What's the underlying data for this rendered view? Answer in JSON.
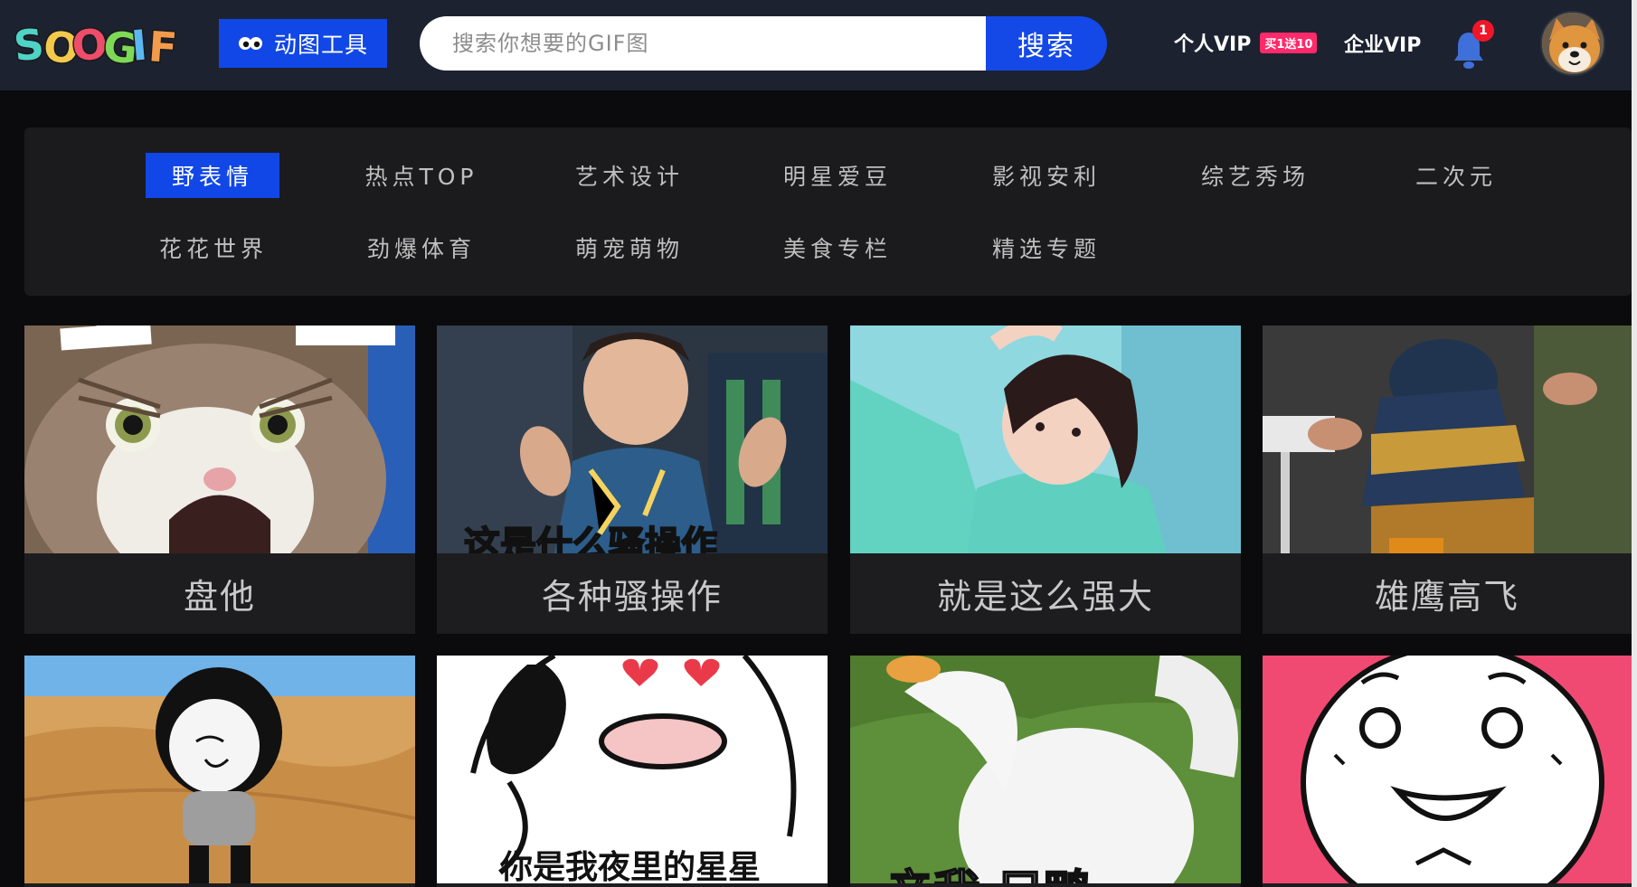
{
  "header": {
    "logo_text": "SOOGIF",
    "tool_button": "动图工具",
    "search_placeholder": "搜索你想要的GIF图",
    "search_button": "搜索",
    "vip_label": "个人VIP",
    "vip_badge": "买1送10",
    "biz_vip_label": "企业VIP",
    "notification_count": "1"
  },
  "categories": [
    {
      "label": "野表情",
      "active": true
    },
    {
      "label": "热点TOP"
    },
    {
      "label": "艺术设计"
    },
    {
      "label": "明星爱豆"
    },
    {
      "label": "影视安利"
    },
    {
      "label": "综艺秀场"
    },
    {
      "label": "二次元"
    },
    {
      "label": "花花世界"
    },
    {
      "label": "劲爆体育"
    },
    {
      "label": "萌宠萌物"
    },
    {
      "label": "美食专栏"
    },
    {
      "label": "精选专题"
    }
  ],
  "cards": [
    {
      "title": "盘他"
    },
    {
      "title": "各种骚操作",
      "overlay": "这是什么骚操作"
    },
    {
      "title": "就是这么强大"
    },
    {
      "title": "雄鹰高飞"
    },
    {
      "title": ""
    },
    {
      "title": "",
      "overlay": "你是我夜里的星星"
    },
    {
      "title": "",
      "overlay": "辛我 只鸭"
    },
    {
      "title": ""
    }
  ],
  "colors": {
    "header_bg": "#1c2230",
    "accent_blue": "#1147e6",
    "page_bg": "#0b0b0d",
    "panel_bg": "#1b1b1d",
    "badge_pink": "#ff2a6a",
    "notification_red": "#f01628"
  }
}
